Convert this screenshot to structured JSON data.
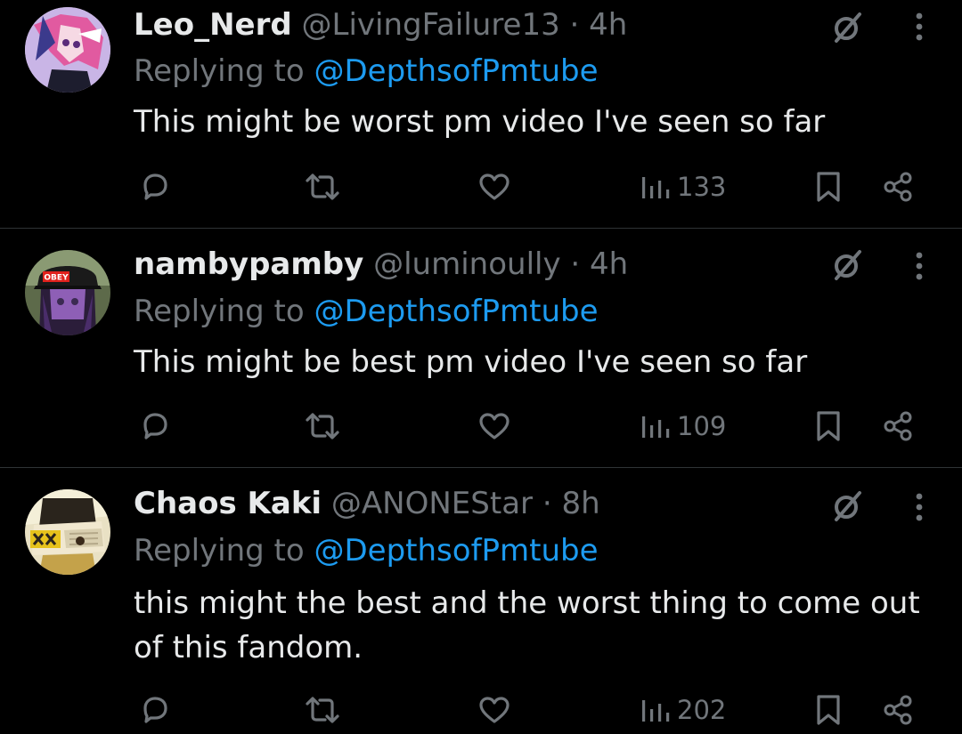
{
  "theme": {
    "background": "#000000",
    "primary_text": "#e7e9ea",
    "secondary_text": "#71767b",
    "link": "#1d9bf0",
    "divider": "#2f3336"
  },
  "replies": [
    {
      "display_name": "Leo_Nerd",
      "handle": "@LivingFailure13",
      "time": "4h",
      "replying_prefix": "Replying to ",
      "replying_to": "@DepthsofPmtube",
      "text": "This might be worst pm video I've seen so far",
      "views": "133",
      "avatar_icon": "anime-avatar-pink-hair"
    },
    {
      "display_name": "nambypamby",
      "handle": "@luminoully",
      "time": "4h",
      "replying_prefix": "Replying to ",
      "replying_to": "@DepthsofPmtube",
      "text": "This might be best pm video I've seen so far",
      "views": "109",
      "avatar_icon": "anime-avatar-obey-cap",
      "avatar_cap_text": "OBEY"
    },
    {
      "display_name": "Chaos Kaki",
      "handle": "@ANONEStar",
      "time": "8h",
      "replying_prefix": "Replying to ",
      "replying_to": "@DepthsofPmtube",
      "text": "this might the best and the worst thing to come out of this fandom.",
      "views": "202",
      "avatar_icon": "anime-avatar-bandaged"
    }
  ],
  "separator": " · ",
  "icons": {
    "more": "more-vertical-icon",
    "grok": "grok-slash-icon",
    "reply": "reply-bubble-icon",
    "repost": "repost-arrows-icon",
    "like": "heart-icon",
    "views": "bar-chart-icon",
    "bookmark": "bookmark-icon",
    "share": "share-nodes-icon"
  }
}
